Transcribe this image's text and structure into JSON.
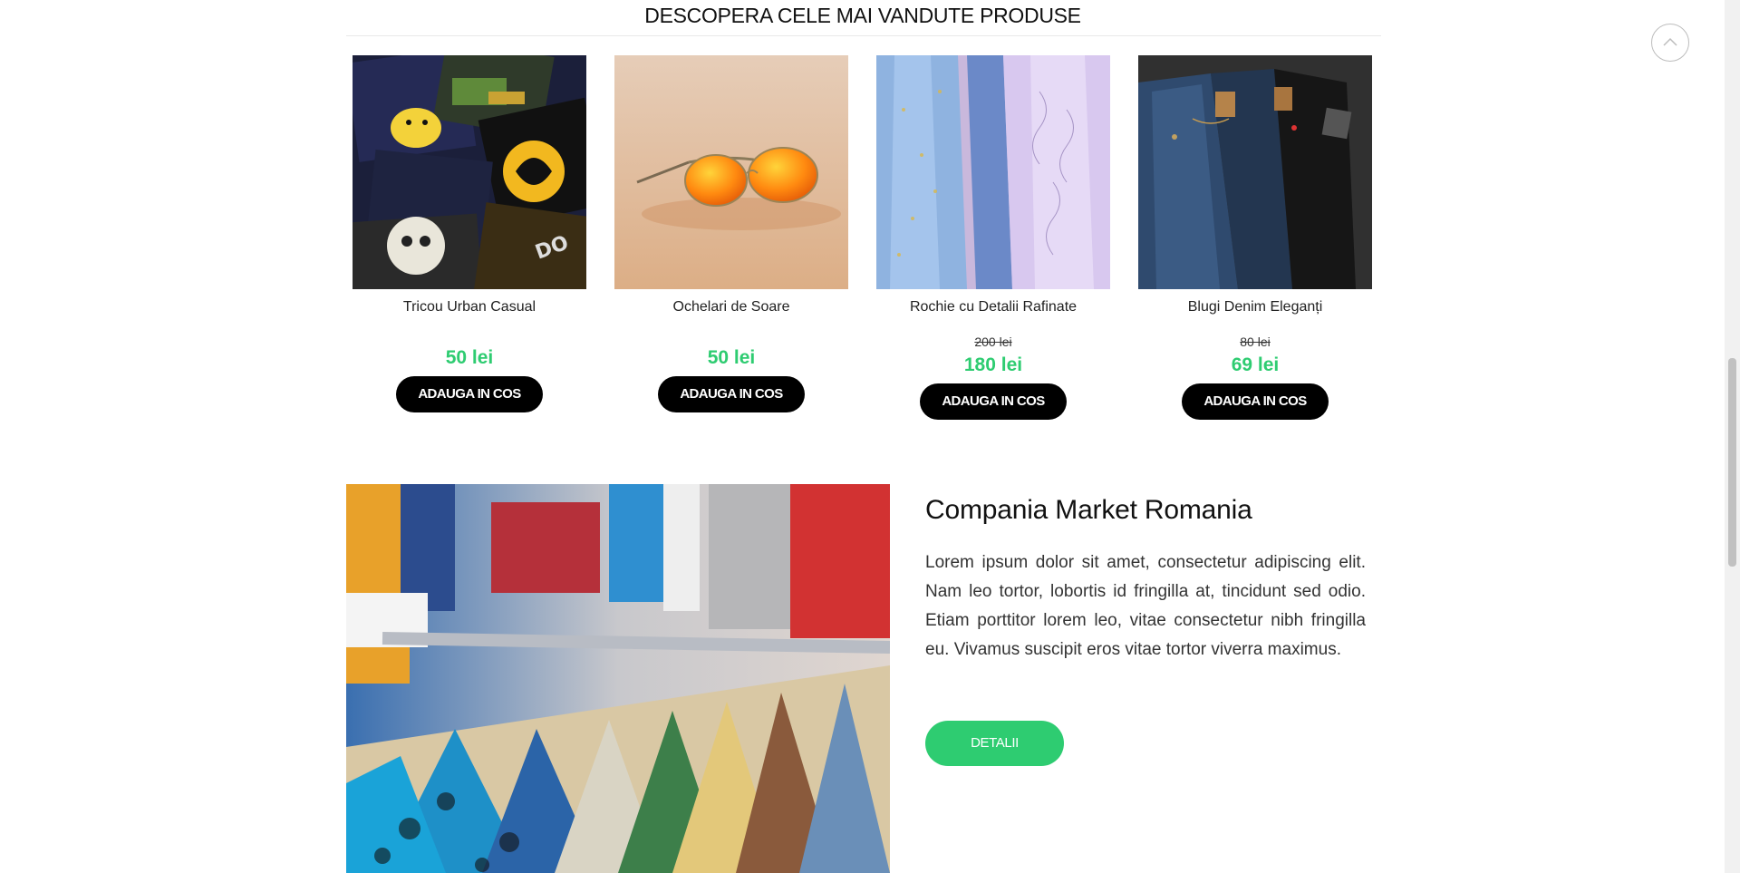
{
  "section": {
    "title": "DESCOPERA CELE MAI VANDUTE PRODUSE"
  },
  "products": [
    {
      "name": "Tricou Urban Casual",
      "old_price": "",
      "price": "50 lei",
      "button": "ADAUGA IN COS",
      "image": "t-shirts-photo"
    },
    {
      "name": "Ochelari de Soare",
      "old_price": "",
      "price": "50 lei",
      "button": "ADAUGA IN COS",
      "image": "sunglasses-photo"
    },
    {
      "name": "Rochie cu Detalii Rafinate",
      "old_price": "200 lei",
      "price": "180 lei",
      "button": "ADAUGA IN COS",
      "image": "dresses-photo"
    },
    {
      "name": "Blugi Denim Eleganți",
      "old_price": "80 lei",
      "price": "69 lei",
      "button": "ADAUGA IN COS",
      "image": "jeans-photo"
    }
  ],
  "about": {
    "title": "Compania Market Romania",
    "text": "Lorem ipsum dolor sit amet, consectetur adipiscing elit. Nam leo tortor, lobortis id fringilla at, tincidunt sed odio. Etiam porttitor lorem leo, vitae consectetur nibh fringilla eu. Vivamus suscipit eros vitae tortor viverra maximus.",
    "button": "DETALII",
    "image": "clothing-rack-photo"
  },
  "back_to_top_icon": "chevron-up-icon",
  "colors": {
    "accent_green": "#2ecc71",
    "button_black": "#000000"
  }
}
